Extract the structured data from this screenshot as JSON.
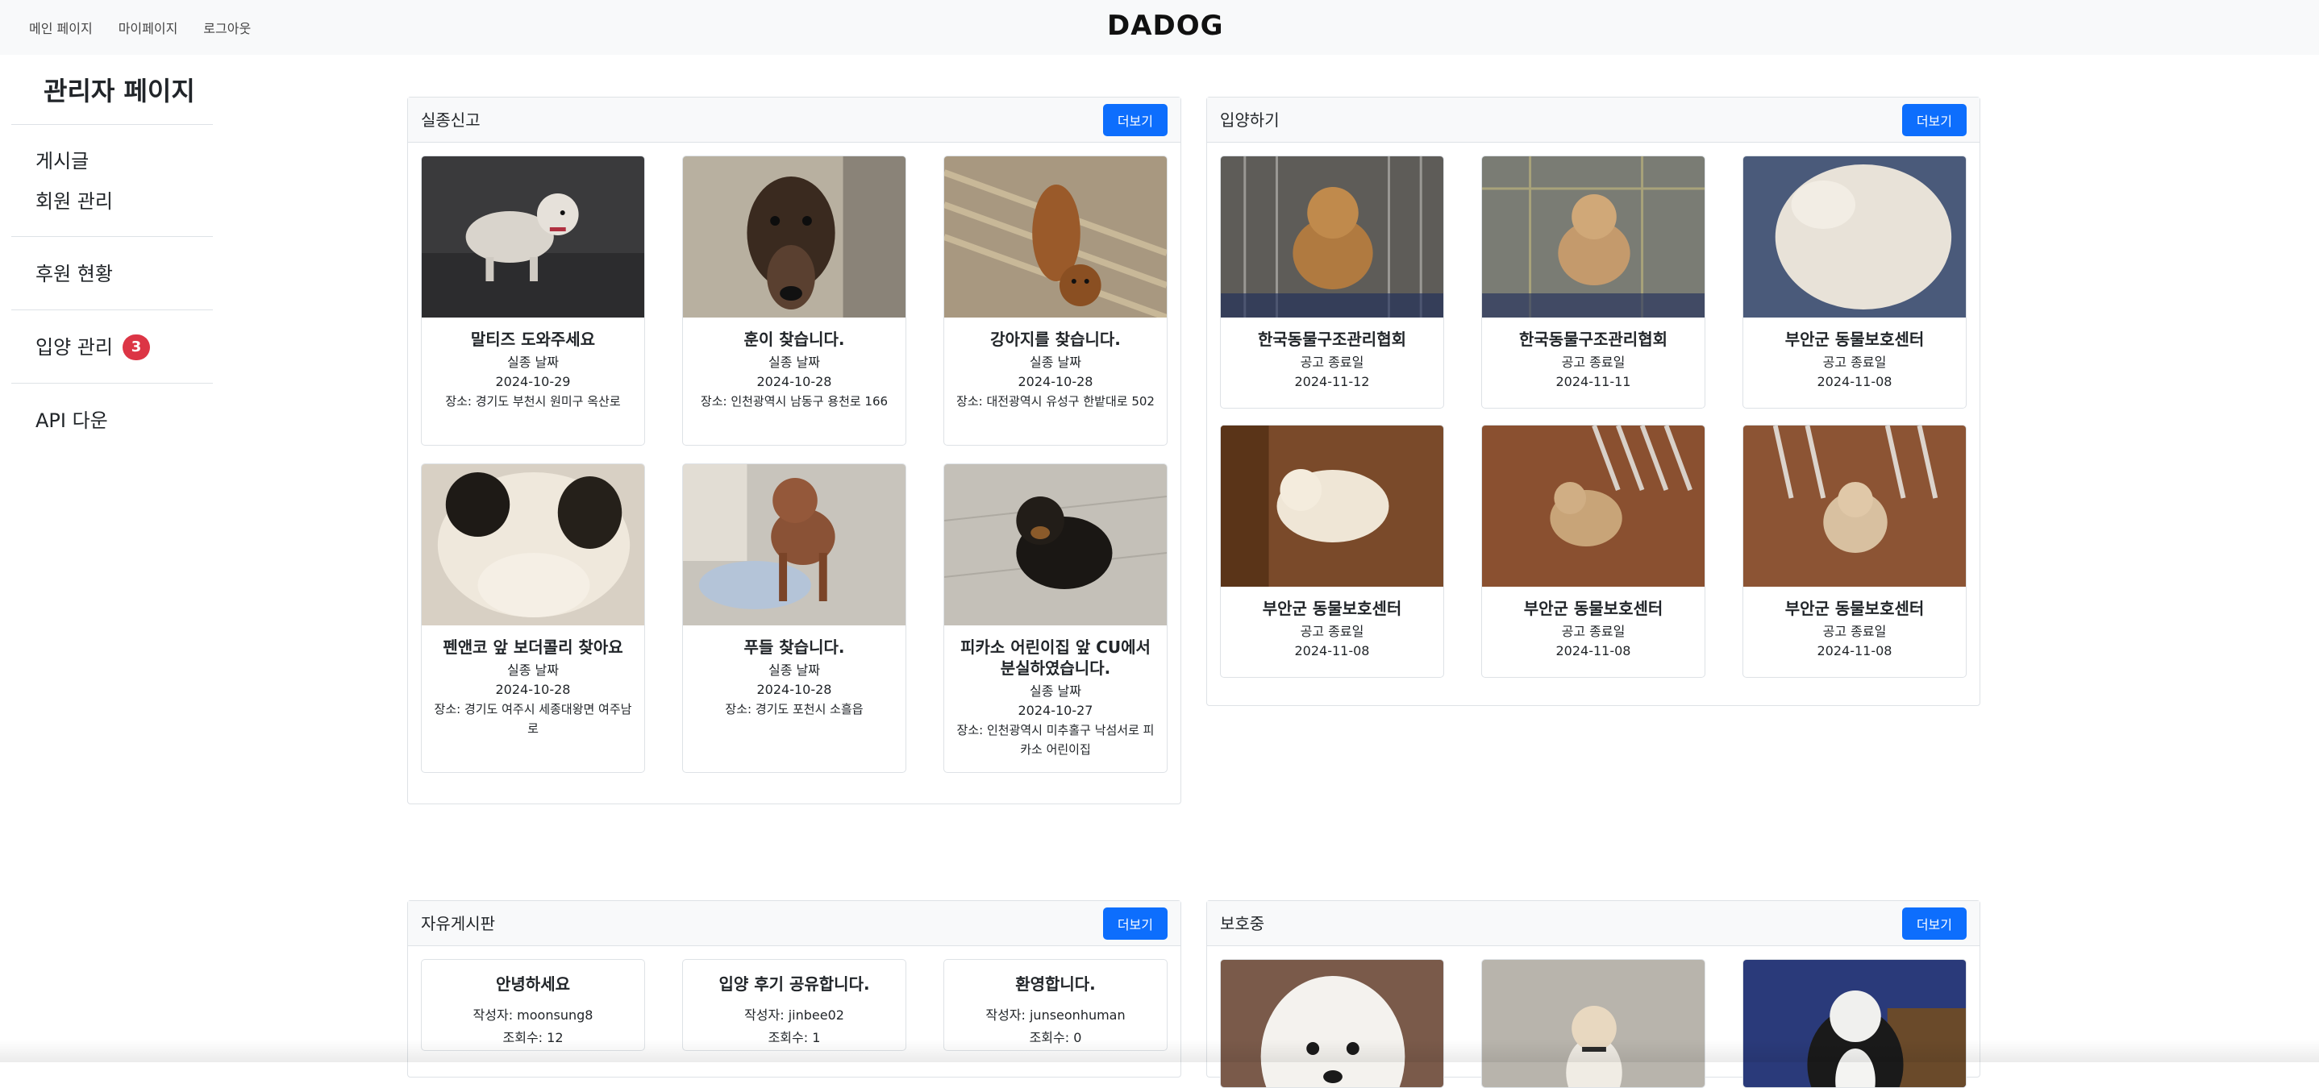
{
  "nav": {
    "links": [
      "메인 페이지",
      "마이페이지",
      "로그아웃"
    ],
    "brand": "DADOG"
  },
  "sidebar": {
    "title": "관리자 페이지",
    "items": [
      {
        "label": "게시글"
      },
      {
        "label": "회원 관리"
      },
      {
        "label": "후원 현황"
      },
      {
        "label": "입양 관리",
        "badge": "3"
      },
      {
        "label": "API 다운"
      }
    ]
  },
  "panels": {
    "missing": {
      "title": "실종신고",
      "more": "더보기",
      "cards": [
        {
          "title": "말티즈 도와주세요",
          "date_label": "실종 날짜",
          "date": "2024-10-29",
          "place": "장소: 경기도 부천시 원미구 옥산로"
        },
        {
          "title": "훈이 찾습니다.",
          "date_label": "실종 날짜",
          "date": "2024-10-28",
          "place": "장소: 인천광역시 남동구 용천로 166"
        },
        {
          "title": "강아지를 찾습니다.",
          "date_label": "실종 날짜",
          "date": "2024-10-28",
          "place": "장소: 대전광역시 유성구 한밭대로 502"
        },
        {
          "title": "펜앤코 앞 보더콜리 찾아요",
          "date_label": "실종 날짜",
          "date": "2024-10-28",
          "place": "장소: 경기도 여주시 세종대왕면 여주남로"
        },
        {
          "title": "푸들 찾습니다.",
          "date_label": "실종 날짜",
          "date": "2024-10-28",
          "place": "장소: 경기도 포천시 소흘읍"
        },
        {
          "title": "피카소 어린이집 앞 CU에서 분실하였습니다.",
          "date_label": "실종 날짜",
          "date": "2024-10-27",
          "place": "장소: 인천광역시 미추홀구 낙섬서로 피카소 어린이집"
        }
      ]
    },
    "adopt": {
      "title": "입양하기",
      "more": "더보기",
      "cards": [
        {
          "title": "한국동물구조관리협회",
          "date_label": "공고 종료일",
          "date": "2024-11-12"
        },
        {
          "title": "한국동물구조관리협회",
          "date_label": "공고 종료일",
          "date": "2024-11-11"
        },
        {
          "title": "부안군 동물보호센터",
          "date_label": "공고 종료일",
          "date": "2024-11-08"
        },
        {
          "title": "부안군 동물보호센터",
          "date_label": "공고 종료일",
          "date": "2024-11-08"
        },
        {
          "title": "부안군 동물보호센터",
          "date_label": "공고 종료일",
          "date": "2024-11-08"
        },
        {
          "title": "부안군 동물보호센터",
          "date_label": "공고 종료일",
          "date": "2024-11-08"
        }
      ]
    },
    "board": {
      "title": "자유게시판",
      "more": "더보기",
      "posts": [
        {
          "title": "안녕하세요",
          "author": "작성자: moonsung8",
          "views": "조회수: 12"
        },
        {
          "title": "입양 후기 공유합니다.",
          "author": "작성자: jinbee02",
          "views": "조회수: 1"
        },
        {
          "title": "환영합니다.",
          "author": "작성자: junseonhuman",
          "views": "조회수: 0"
        }
      ]
    },
    "protect": {
      "title": "보호중",
      "more": "더보기"
    }
  }
}
